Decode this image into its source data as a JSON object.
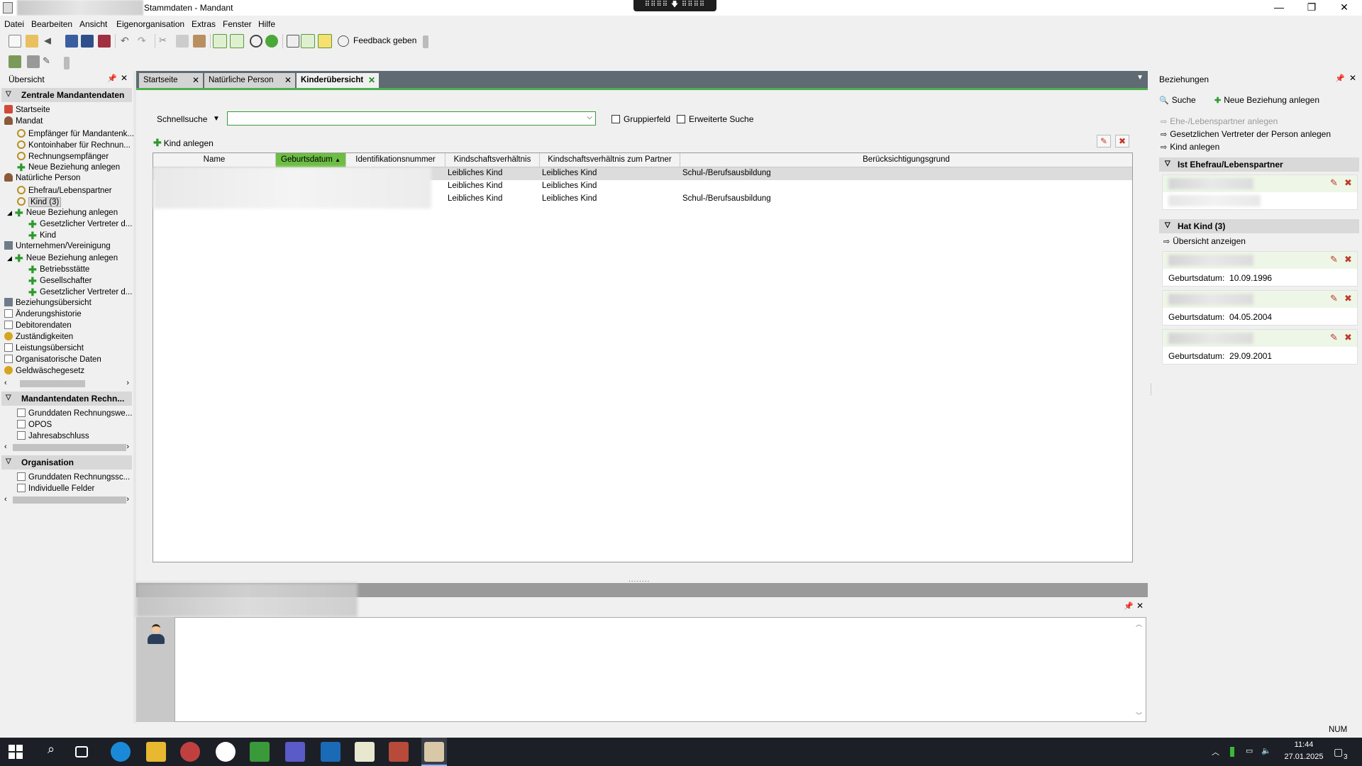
{
  "window": {
    "title": "Stammdaten - Mandant",
    "minimize_glyph": "—",
    "restore_glyph": "❐",
    "close_glyph": "✕",
    "remote_bar_label": "⠿⠿⠿⠿ 🡇 ⠿⠿⠿⠿"
  },
  "menu": {
    "items": [
      "Datei",
      "Bearbeiten",
      "Ansicht",
      "Eigenorganisation",
      "Extras",
      "Fenster",
      "Hilfe"
    ]
  },
  "toolbar": {
    "feedback_label": "Feedback geben",
    "icons": [
      "new-icon",
      "open-icon",
      "back-icon",
      "save-icon",
      "save-all-icon",
      "save-close-icon",
      "undo-icon",
      "redo-icon",
      "cut-icon",
      "copy-icon",
      "paste-icon",
      "filter-icon",
      "list-icon",
      "history-icon",
      "help-icon",
      "excel-icon",
      "document-icon",
      "note-icon",
      "feedback-icon"
    ]
  },
  "left_panel": {
    "title": "Übersicht",
    "pin": "📌",
    "close": "✕",
    "sections": [
      {
        "label": "Zentrale Mandantendaten",
        "items": [
          {
            "label": "Startseite",
            "icon": "home-icon"
          },
          {
            "label": "Mandat",
            "icon": "person-icon"
          },
          {
            "label": "Empfänger für Mandantenk...",
            "icon": "link-icon"
          },
          {
            "label": "Kontoinhaber für Rechnun...",
            "icon": "link-icon"
          },
          {
            "label": "Rechnungsempfänger",
            "icon": "link-icon"
          },
          {
            "label": "Neue Beziehung anlegen",
            "icon": "plus-icon"
          },
          {
            "label": "Natürliche Person",
            "icon": "person-icon"
          },
          {
            "label": "Ehefrau/Lebenspartner",
            "icon": "link-icon"
          },
          {
            "label": "Kind (3)",
            "icon": "link-icon"
          },
          {
            "label": "Neue Beziehung anlegen",
            "icon": "plus-icon"
          },
          {
            "label": "Gesetzlicher Vertreter d...",
            "icon": "plus-icon"
          },
          {
            "label": "Kind",
            "icon": "plus-icon"
          },
          {
            "label": "Unternehmen/Vereinigung",
            "icon": "building-icon"
          },
          {
            "label": "Neue Beziehung anlegen",
            "icon": "plus-icon"
          },
          {
            "label": "Betriebsstätte",
            "icon": "plus-icon"
          },
          {
            "label": "Gesellschafter",
            "icon": "plus-icon"
          },
          {
            "label": "Gesetzlicher Vertreter d...",
            "icon": "plus-icon"
          },
          {
            "label": "Beziehungsübersicht",
            "icon": "relations-icon"
          },
          {
            "label": "Änderungshistorie",
            "icon": "document-icon"
          },
          {
            "label": "Debitorendaten",
            "icon": "document-icon"
          },
          {
            "label": "Zuständigkeiten",
            "icon": "responsibility-icon"
          },
          {
            "label": "Leistungsübersicht",
            "icon": "document-icon"
          },
          {
            "label": "Organisatorische Daten",
            "icon": "document-icon"
          },
          {
            "label": "Geldwäschegesetz",
            "icon": "coins-icon"
          }
        ]
      },
      {
        "label": "Mandantendaten Rechn...",
        "items": [
          {
            "label": "Grunddaten Rechnungswe...",
            "icon": "document-icon"
          },
          {
            "label": "OPOS",
            "icon": "document-icon"
          },
          {
            "label": "Jahresabschluss",
            "icon": "document-icon"
          }
        ]
      },
      {
        "label": "Organisation",
        "items": [
          {
            "label": "Grunddaten Rechnungssc...",
            "icon": "document-icon"
          },
          {
            "label": "Individuelle Felder",
            "icon": "document-icon"
          }
        ]
      }
    ]
  },
  "doc_tabs": [
    {
      "label": "Startseite",
      "active": false
    },
    {
      "label": "Natürliche Person",
      "active": false
    },
    {
      "label": "Kinderübersicht",
      "active": true
    }
  ],
  "main": {
    "schnellsuche_label": "Schnellsuche",
    "search_value": "",
    "checkbox_gruppierfeld": "Gruppierfeld",
    "checkbox_erweiterte_suche": "Erweiterte Suche",
    "kind_anlegen": "Kind anlegen",
    "columns": [
      "Name",
      "Geburtsdatum",
      "Identifikationsnummer",
      "Kindschaftsverhältnis",
      "Kindschaftsverhältnis zum Partner",
      "Berücksichtigungsgrund"
    ],
    "sorted_column": "Geburtsdatum",
    "rows": [
      {
        "kindschaft": "Leibliches Kind",
        "kindschaft_partner": "Leibliches Kind",
        "grund": "Schul-/Berufsausbildung"
      },
      {
        "kindschaft": "Leibliches Kind",
        "kindschaft_partner": "Leibliches Kind",
        "grund": ""
      },
      {
        "kindschaft": "Leibliches Kind",
        "kindschaft_partner": "Leibliches Kind",
        "grund": "Schul-/Berufsausbildung"
      }
    ]
  },
  "right_panel": {
    "title": "Beziehungen",
    "search_label": "Suche",
    "new_relation_label": "Neue Beziehung anlegen",
    "links": [
      {
        "label": "Ehe-/Lebenspartner anlegen",
        "disabled": true
      },
      {
        "label": "Gesetzlichen Vertreter der Person anlegen",
        "disabled": false
      },
      {
        "label": "Kind anlegen",
        "disabled": false
      }
    ],
    "section_partner": "Ist Ehefrau/Lebenspartner",
    "section_children": "Hat Kind (3)",
    "overview_link": "Übersicht anzeigen",
    "children": [
      {
        "birth_label": "Geburtsdatum:",
        "birth_value": "10.09.1996"
      },
      {
        "birth_label": "Geburtsdatum:",
        "birth_value": "04.05.2004"
      },
      {
        "birth_label": "Geburtsdatum:",
        "birth_value": "29.09.2001"
      }
    ]
  },
  "statusbar": {
    "num": "NUM"
  },
  "taskbar": {
    "time": "11:44",
    "date": "27.01.2025",
    "notification_count": "3"
  }
}
